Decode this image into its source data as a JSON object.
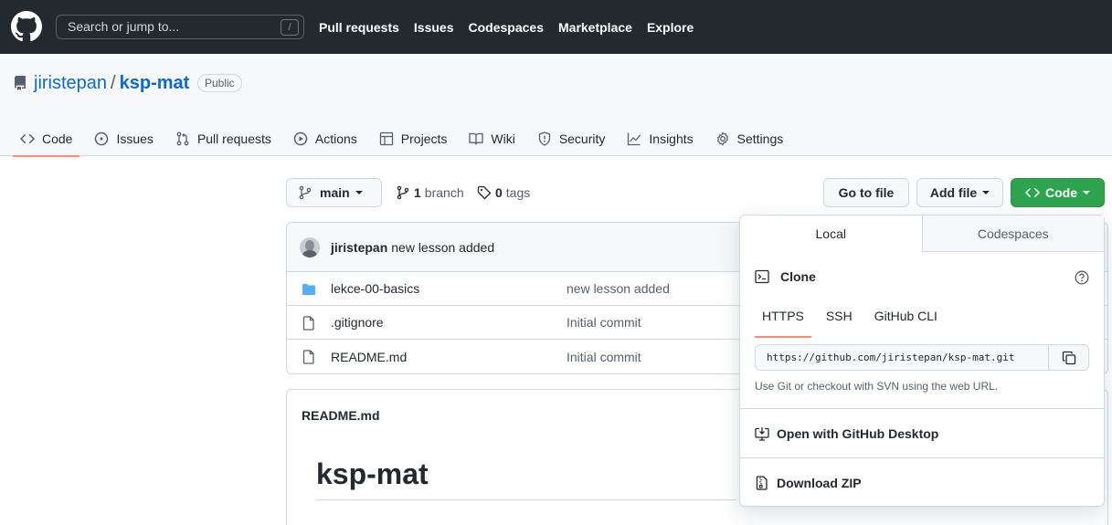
{
  "header": {
    "search_placeholder": "Search or jump to...",
    "search_kbd": "/",
    "nav": [
      "Pull requests",
      "Issues",
      "Codespaces",
      "Marketplace",
      "Explore"
    ]
  },
  "repo": {
    "owner": "jiristepan",
    "separator": "/",
    "name": "ksp-mat",
    "visibility": "Public",
    "tabs": [
      {
        "label": "Code",
        "icon": "code-icon"
      },
      {
        "label": "Issues",
        "icon": "issue-icon"
      },
      {
        "label": "Pull requests",
        "icon": "pull-request-icon"
      },
      {
        "label": "Actions",
        "icon": "play-icon"
      },
      {
        "label": "Projects",
        "icon": "table-icon"
      },
      {
        "label": "Wiki",
        "icon": "book-icon"
      },
      {
        "label": "Security",
        "icon": "shield-icon"
      },
      {
        "label": "Insights",
        "icon": "graph-icon"
      },
      {
        "label": "Settings",
        "icon": "gear-icon"
      }
    ]
  },
  "branchbar": {
    "branch": "main",
    "branch_count": "1",
    "branch_word": "branch",
    "tag_count": "0",
    "tag_word": "tags",
    "go_to_file": "Go to file",
    "add_file": "Add file",
    "code": "Code"
  },
  "commit": {
    "author": "jiristepan",
    "message": "new lesson added"
  },
  "files": [
    {
      "name": "lekce-00-basics",
      "message": "new lesson added",
      "type": "folder"
    },
    {
      "name": ".gitignore",
      "message": "Initial commit",
      "type": "file"
    },
    {
      "name": "README.md",
      "message": "Initial commit",
      "type": "file"
    }
  ],
  "readme": {
    "file": "README.md",
    "heading": "ksp-mat"
  },
  "clone": {
    "tab_local": "Local",
    "tab_codespaces": "Codespaces",
    "title": "Clone",
    "protocols": [
      "HTTPS",
      "SSH",
      "GitHub CLI"
    ],
    "url": "https://github.com/jiristepan/ksp-mat.git",
    "hint": "Use Git or checkout with SVN using the web URL.",
    "open_desktop": "Open with GitHub Desktop",
    "download_zip": "Download ZIP"
  },
  "colors": {
    "header_bg": "#24292f",
    "link": "#0969da",
    "accent_underline": "#fd8c73",
    "primary_button": "#2da44e"
  }
}
